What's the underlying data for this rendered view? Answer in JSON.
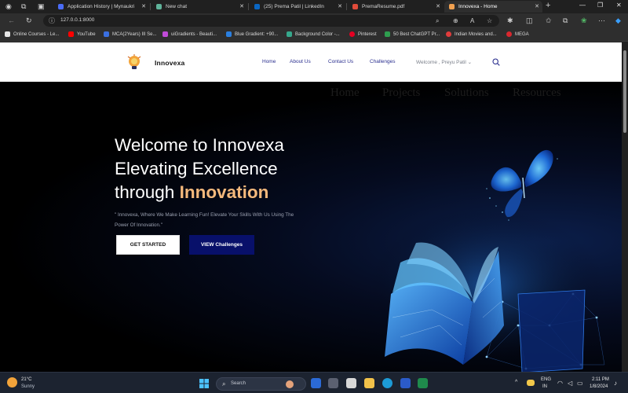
{
  "browser": {
    "tabs": [
      {
        "label": "Application History | Mynaukri",
        "favicon_color": "#4a6cf7"
      },
      {
        "label": "New chat",
        "favicon_color": "#5fb39a"
      },
      {
        "label": "(25) Prema Patil | LinkedIn",
        "favicon_color": "#0a66c2"
      },
      {
        "label": "PremaResume.pdf",
        "favicon_color": "#e04b3a"
      },
      {
        "label": "Innovexa - Home",
        "favicon_color": "#f0a050"
      }
    ],
    "url": "127.0.0.1:8000",
    "bookmarks": [
      {
        "label": "Online Courses - Le...",
        "favicon_color": "#e6e6e6"
      },
      {
        "label": "YouTube",
        "favicon_color": "#ff0000"
      },
      {
        "label": "MCA(2Years) III Se...",
        "favicon_color": "#3a6fe0"
      },
      {
        "label": "uiGradients - Beauti...",
        "favicon_color": "#c04bd8"
      },
      {
        "label": "Blue Gradient: +90...",
        "favicon_color": "#2a7fe0"
      },
      {
        "label": "Background Color -...",
        "favicon_color": "#36a88c"
      },
      {
        "label": "Pinterest",
        "favicon_color": "#e60023"
      },
      {
        "label": "50 Best ChatGPT Pr...",
        "favicon_color": "#2e9e4f"
      },
      {
        "label": "Indian Movies and...",
        "favicon_color": "#e03c3c"
      },
      {
        "label": "MEGA",
        "favicon_color": "#d9272e"
      }
    ]
  },
  "site": {
    "logo": "Innovexa",
    "nav": {
      "home": "Home",
      "about": "About Us",
      "contact": "Contact Us",
      "challenges": "Challenges",
      "user": "Welcome , Preyu Patil"
    },
    "ghost_nav": [
      "Home",
      "Projects",
      "Solutions",
      "Resources"
    ],
    "hero": {
      "line1": "Welcome to Innovexa",
      "line2": "Elevating Excellence",
      "line3_prefix": "through",
      "line3_accent": "Innovation",
      "tagline": "\" Innovexa, Where We Make Learning Fun! Elevate Your Skills With Us Using The Power Of Innovation.\"",
      "cta_primary": "GET STARTED",
      "cta_secondary": "VIEW Challenges"
    },
    "colors": {
      "accent": "#f5b97c",
      "nav_link": "#2a2f8f",
      "button_dark": "#08106a"
    }
  },
  "taskbar": {
    "weather_temp": "21°C",
    "weather_desc": "Sunny",
    "search_placeholder": "Search",
    "language": "ENG",
    "region": "IN",
    "time": "2:11 PM",
    "date": "1/8/2024"
  }
}
